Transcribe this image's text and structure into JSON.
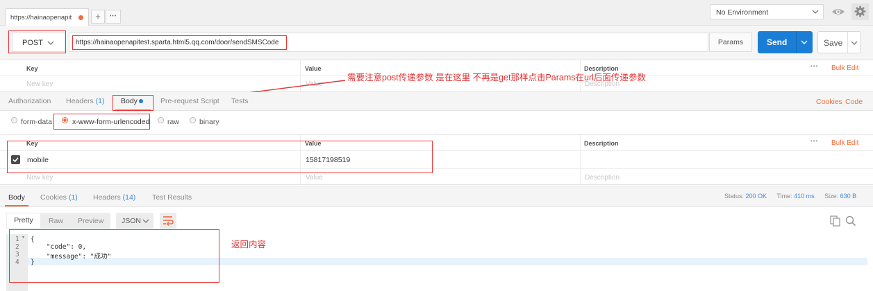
{
  "tab": {
    "title": "https://hainaopenapit",
    "add": "+",
    "more": "•••"
  },
  "environment": {
    "selected": "No Environment"
  },
  "request": {
    "method": "POST",
    "url": "https://hainaopenapitest.sparta.html5.qq.com/door/sendSMSCode",
    "params_label": "Params",
    "send_label": "Send",
    "save_label": "Save"
  },
  "params_table": {
    "columns": {
      "key": "Key",
      "value": "Value",
      "description": "Description"
    },
    "bulk_edit": "Bulk Edit",
    "placeholders": {
      "key": "New key",
      "value": "Value",
      "description": "Description"
    }
  },
  "annotations": {
    "post_note": "需要注意post传递参数 是在这里 不再是get那样点击Params在url后面传递参数",
    "response_note": "返回内容"
  },
  "request_tabs": {
    "authorization": "Authorization",
    "headers": "Headers",
    "headers_count": "(1)",
    "body": "Body",
    "prerequest": "Pre-request Script",
    "tests": "Tests",
    "cookies": "Cookies",
    "code": "Code"
  },
  "body_types": [
    "form-data",
    "x-www-form-urlencoded",
    "raw",
    "binary"
  ],
  "body_table": {
    "columns": {
      "key": "Key",
      "value": "Value",
      "description": "Description"
    },
    "bulk_edit": "Bulk Edit",
    "rows": [
      {
        "key": "mobile",
        "value": "15817198519",
        "checked": true
      }
    ],
    "placeholders": {
      "key": "New key",
      "value": "Value",
      "description": "Description"
    }
  },
  "response_tabs": {
    "body": "Body",
    "cookies": "Cookies",
    "cookies_count": "(1)",
    "headers": "Headers",
    "headers_count": "(14)",
    "tests": "Test Results"
  },
  "response_status": {
    "status_label": "Status:",
    "status_value": "200 OK",
    "time_label": "Time:",
    "time_value": "410 ms",
    "size_label": "Size:",
    "size_value": "630 B"
  },
  "view_modes": {
    "pretty": "Pretty",
    "raw": "Raw",
    "preview": "Preview",
    "format": "JSON"
  },
  "code_lines": [
    {
      "num": "1",
      "text": "{"
    },
    {
      "num": "2",
      "text": "    \"code\": 0,"
    },
    {
      "num": "3",
      "text": "    \"message\": \"成功\""
    },
    {
      "num": "4",
      "text": "}"
    }
  ],
  "colors": {
    "accent": "#f26b3a",
    "send": "#1b7ed6",
    "link_blue": "#3b8ce0",
    "annotation": "#e33333"
  },
  "icons": [
    "chevron-down-icon",
    "eye-icon",
    "gear-icon",
    "checkbox-icon",
    "wrap-icon",
    "copy-icon",
    "search-icon"
  ]
}
